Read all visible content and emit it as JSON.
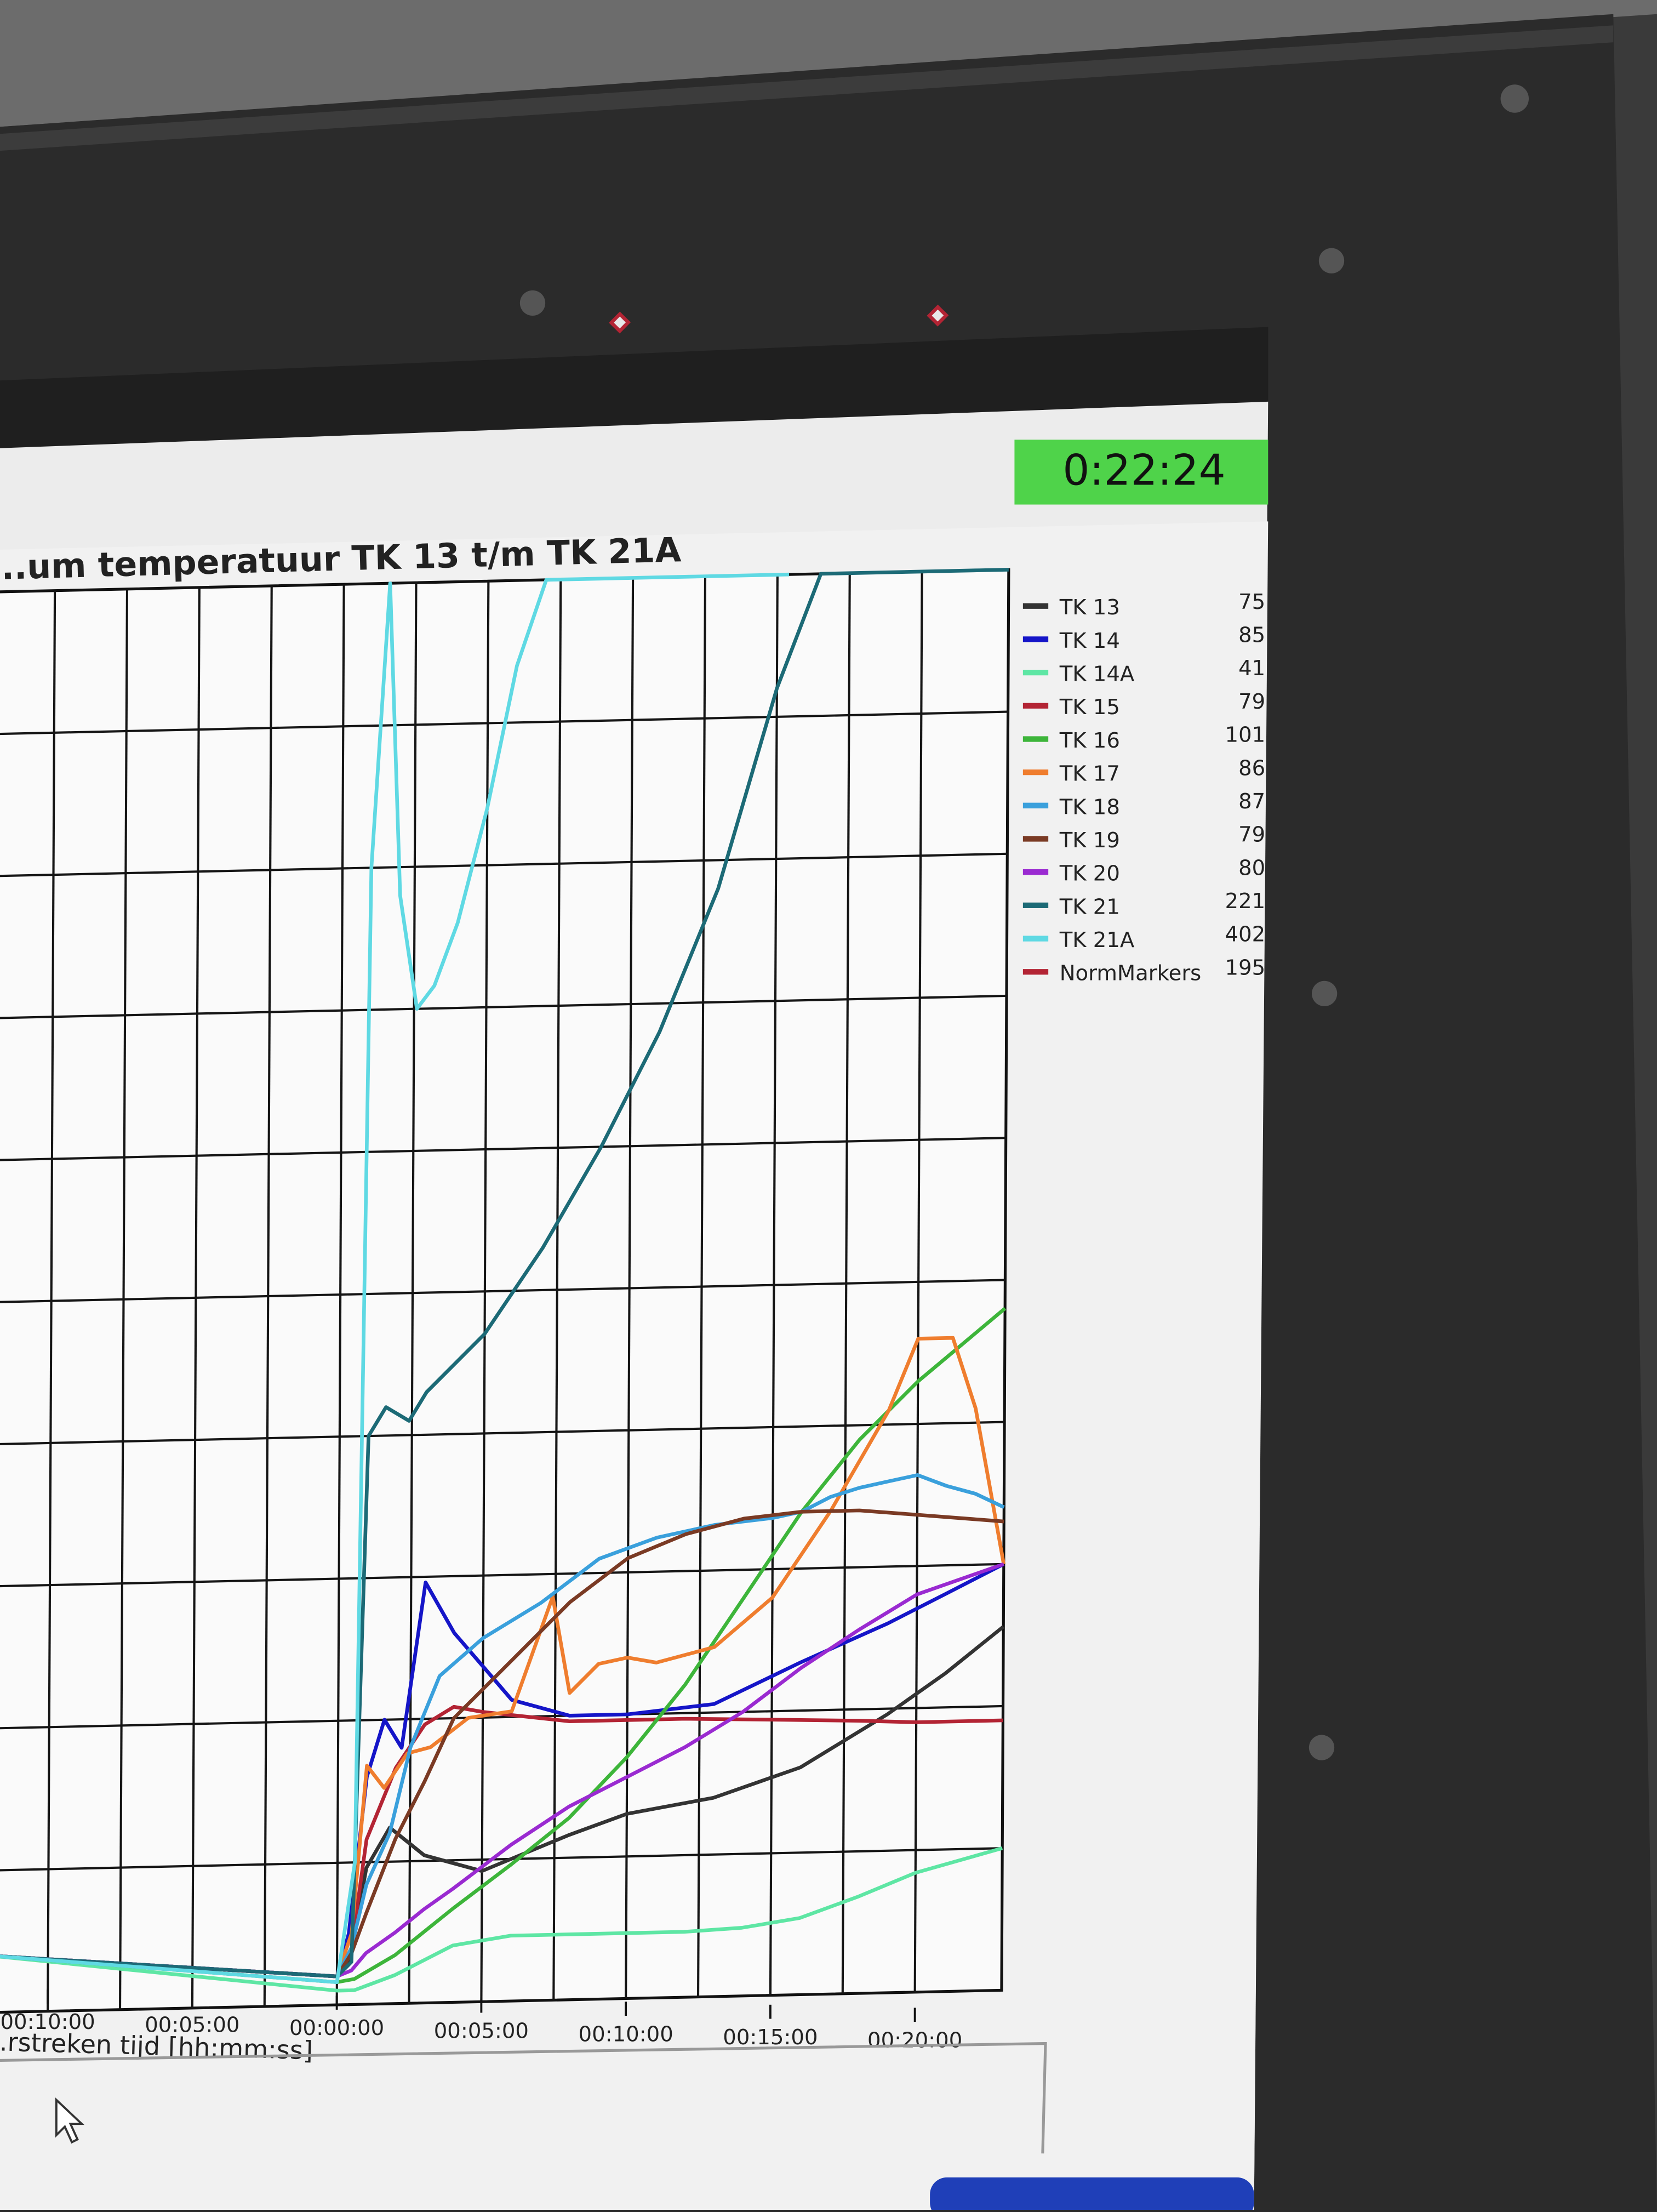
{
  "timer": {
    "value": "0:22:24",
    "color": "#4fd34a"
  },
  "chart_data": {
    "type": "line",
    "title": "...um temperatuur TK 13 t/m TK 21A",
    "xlabel": "...rstreken tijd [hh:mm:ss]",
    "ylabel": "",
    "x_tick_labels": [
      "00:10:00",
      "00:05:00",
      "00:00:00",
      "00:05:00",
      "00:10:00",
      "00:15:00",
      "00:20:00"
    ],
    "x_tick_values": [
      -10,
      -5,
      0,
      5,
      10,
      15,
      20
    ],
    "xlim": [
      -12,
      23
    ],
    "ylim": [
      0,
      500
    ],
    "grid": true,
    "legend_position": "right",
    "series": [
      {
        "name": "TK 13",
        "value": "75",
        "color": "#333333",
        "x": [
          -12,
          0,
          0.4,
          1,
          1.8,
          3,
          5,
          8,
          10,
          13,
          16,
          19,
          21,
          23
        ],
        "y": [
          20,
          10,
          14,
          48,
          62,
          52,
          46,
          58,
          65,
          70,
          80,
          98,
          112,
          128
        ]
      },
      {
        "name": "TK 14",
        "value": "85",
        "color": "#1515c8",
        "x": [
          -12,
          0,
          0.4,
          1,
          1.6,
          2.2,
          3,
          4,
          6,
          8,
          10,
          13,
          16,
          19,
          21,
          23
        ],
        "y": [
          20,
          10,
          25,
          80,
          100,
          90,
          148,
          130,
          106,
          100,
          100,
          103,
          117,
          130,
          140,
          150
        ]
      },
      {
        "name": "TK 14A",
        "value": "41",
        "color": "#5ee6a4",
        "x": [
          -12,
          0,
          0.6,
          2,
          4,
          6,
          8,
          10,
          12,
          14,
          16,
          18,
          20,
          23
        ],
        "y": [
          20,
          5,
          5,
          10,
          20,
          23,
          23,
          23,
          23,
          24,
          27,
          34,
          42,
          50
        ]
      },
      {
        "name": "TK 15",
        "value": "79",
        "color": "#b32434",
        "x": [
          -12,
          0,
          0.5,
          1,
          2,
          3,
          4,
          5,
          8,
          10,
          12,
          15,
          18,
          20,
          23
        ],
        "y": [
          20,
          10,
          20,
          58,
          83,
          98,
          104,
          102,
          98,
          98,
          98,
          97,
          96,
          95,
          95
        ]
      },
      {
        "name": "TK 16",
        "value": "101",
        "color": "#3db53a",
        "x": [
          -12,
          0,
          0.6,
          2,
          4,
          6,
          8,
          10,
          12,
          14,
          16,
          18,
          20,
          23
        ],
        "y": [
          20,
          8,
          9,
          17,
          33,
          48,
          64,
          85,
          110,
          140,
          170,
          195,
          215,
          240
        ]
      },
      {
        "name": "TK 17",
        "value": "86",
        "color": "#ef7d2e",
        "x": [
          -12,
          0,
          0.5,
          1,
          1.6,
          2.4,
          3.2,
          4.5,
          6,
          7.4,
          8,
          9,
          10,
          11,
          13,
          15,
          17,
          19,
          20,
          21.2,
          22,
          23
        ],
        "y": [
          20,
          10,
          25,
          84,
          76,
          88,
          90,
          100,
          102,
          142,
          108,
          118,
          120,
          118,
          123,
          140,
          170,
          205,
          230,
          230,
          205,
          150
        ]
      },
      {
        "name": "TK 18",
        "value": "87",
        "color": "#3aa0dc",
        "x": [
          -12,
          0,
          0.5,
          1,
          1.8,
          2.5,
          3.5,
          5,
          7,
          9,
          11,
          13,
          15,
          16,
          17,
          18,
          19,
          20,
          21,
          22,
          23
        ],
        "y": [
          20,
          10,
          20,
          42,
          60,
          90,
          115,
          128,
          140,
          155,
          162,
          166,
          168,
          170,
          175,
          178,
          180,
          182,
          178,
          175,
          170
        ]
      },
      {
        "name": "TK 19",
        "value": "79",
        "color": "#7a3a24",
        "x": [
          -12,
          0,
          0.5,
          1,
          2,
          3,
          4,
          6,
          8,
          10,
          12,
          14,
          16,
          18,
          20,
          23
        ],
        "y": [
          20,
          10,
          18,
          32,
          58,
          78,
          100,
          120,
          140,
          155,
          163,
          168,
          170,
          170,
          168,
          165
        ]
      },
      {
        "name": "TK 20",
        "value": "80",
        "color": "#9a2ad1",
        "x": [
          -12,
          0,
          0.5,
          1,
          2,
          3,
          4,
          6,
          8,
          10,
          12,
          14,
          16,
          18,
          20,
          23
        ],
        "y": [
          20,
          10,
          12,
          18,
          25,
          33,
          40,
          55,
          68,
          78,
          88,
          100,
          115,
          128,
          140,
          150
        ]
      },
      {
        "name": "TK 21",
        "value": "221",
        "color": "#1c6a76",
        "x": [
          -12,
          0,
          0.5,
          1,
          1.6,
          2.4,
          3,
          5,
          7,
          9,
          11,
          13,
          15,
          16.5,
          18,
          19.2,
          20,
          21,
          22,
          23
        ],
        "y": [
          20,
          10,
          15,
          200,
          210,
          205,
          215,
          235,
          265,
          300,
          340,
          390,
          460,
          510,
          545,
          585,
          600,
          565,
          578,
          625
        ]
      },
      {
        "name": "TK 21A",
        "value": "402",
        "color": "#5fd9e3",
        "x": [
          -12,
          0,
          0.6,
          1,
          1.6,
          2,
          2.6,
          3.2,
          4,
          5,
          6,
          7,
          8,
          9,
          10,
          12,
          14,
          15,
          15.4
        ],
        "y": [
          20,
          8,
          50,
          400,
          500,
          390,
          350,
          358,
          380,
          420,
          470,
          530,
          580,
          635,
          680,
          730,
          790,
          845,
          860
        ]
      },
      {
        "name": "NormMarkers",
        "value": "195",
        "color": "#b32434",
        "x": [
          9.5,
          20.5
        ],
        "y": [
          590,
          590
        ]
      }
    ]
  }
}
